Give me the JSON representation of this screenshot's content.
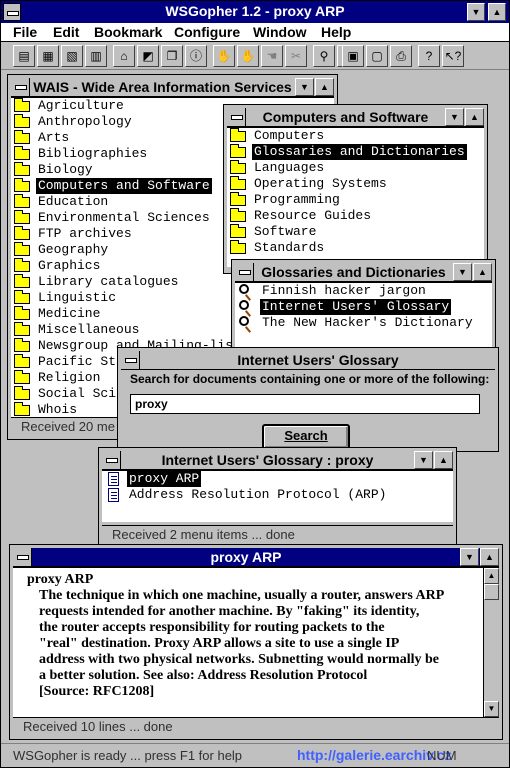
{
  "app": {
    "title": "WSGopher 1.2 -     proxy ARP",
    "menu": [
      "File",
      "Edit",
      "Bookmark",
      "Configure",
      "Window",
      "Help"
    ],
    "status": "WSGopher is ready ... press F1 for help",
    "num": "NUM",
    "watermark": "http://galerie.earchiv.cz"
  },
  "toolbar": {
    "icons": [
      "open-book-icon",
      "open-icon",
      "new-icon",
      "bookmark-icon",
      "home-icon",
      "back-icon",
      "copy-icon",
      "info-icon",
      "stop-icon",
      "hand-icon",
      "hand2-icon",
      "disconnect-icon",
      "search-icon",
      "link-icon",
      "save-icon",
      "clipboard-icon",
      "print-icon",
      "help-icon",
      "context-help-icon"
    ]
  },
  "wais": {
    "title": "WAIS - Wide Area Information Services",
    "items": [
      "Agriculture",
      "Anthropology",
      "Arts",
      "Bibliographies",
      "Biology",
      "Computers and Software",
      "Education",
      "Environmental Sciences",
      "FTP archives",
      "Geography",
      "Graphics",
      "Library catalogues",
      "Linguistic",
      "Medicine",
      "Miscellaneous",
      "Newsgroup and Mailing-lis",
      "Pacific St",
      "Religion",
      "Social Sci",
      "Whois"
    ],
    "selected": 5,
    "status": "Received 20 me"
  },
  "computers": {
    "title": "Computers and Software",
    "items": [
      "Computers",
      "Glossaries and Dictionaries",
      "Languages",
      "Operating Systems",
      "Programming",
      "Resource Guides",
      "Software",
      "Standards"
    ],
    "selected": 1
  },
  "glossaries": {
    "title": "Glossaries and Dictionaries",
    "items": [
      "Finnish hacker jargon",
      "Internet Users' Glossary",
      "The New Hacker's Dictionary"
    ],
    "selected": 1
  },
  "search": {
    "title": "Internet Users' Glossary",
    "label": "Search for documents containing one or more of the following:",
    "value": "proxy",
    "button": "Search"
  },
  "results": {
    "title": "Internet Users' Glossary : proxy",
    "items": [
      "proxy ARP",
      "Address Resolution Protocol (ARP)"
    ],
    "selected": 0,
    "status": "Received 2 menu items ... done"
  },
  "viewer": {
    "title": "proxy ARP",
    "heading": "proxy ARP",
    "lines": [
      "The technique in which one machine, usually a router, answers ARP",
      "requests intended for another machine.  By \"faking\" its identity,",
      "the router accepts responsibility for routing packets to the",
      "\"real\" destination.  Proxy ARP allows a site to use a single IP",
      "address with two physical networks.  Subnetting would normally be",
      "a better solution.  See also: Address Resolution Protocol",
      "[Source: RFC1208]"
    ],
    "status": "Received 10 lines ... done"
  }
}
